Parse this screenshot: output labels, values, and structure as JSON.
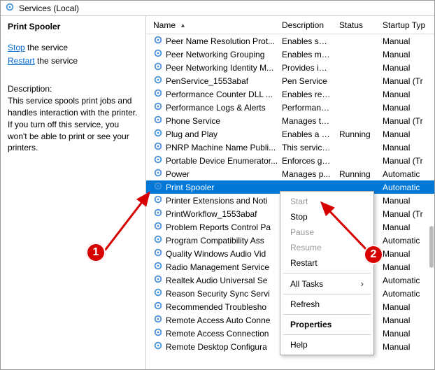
{
  "title": "Services (Local)",
  "left_pane": {
    "service_name": "Print Spooler",
    "stop_link": "Stop",
    "stop_suffix": " the service",
    "restart_link": "Restart",
    "restart_suffix": " the service",
    "desc_label": "Description:",
    "desc_text": "This service spools print jobs and handles interaction with the printer. If you turn off this service, you won't be able to print or see your printers."
  },
  "columns": {
    "name": "Name",
    "description": "Description",
    "status": "Status",
    "startup": "Startup Typ"
  },
  "rows": [
    {
      "name": "Peer Name Resolution Prot...",
      "desc": "Enables serv...",
      "status": "",
      "startup": "Manual"
    },
    {
      "name": "Peer Networking Grouping",
      "desc": "Enables mul...",
      "status": "",
      "startup": "Manual"
    },
    {
      "name": "Peer Networking Identity M...",
      "desc": "Provides ide...",
      "status": "",
      "startup": "Manual"
    },
    {
      "name": "PenService_1553abaf",
      "desc": "Pen Service",
      "status": "",
      "startup": "Manual (Tr"
    },
    {
      "name": "Performance Counter DLL ...",
      "desc": "Enables rem...",
      "status": "",
      "startup": "Manual"
    },
    {
      "name": "Performance Logs & Alerts",
      "desc": "Performanc...",
      "status": "",
      "startup": "Manual"
    },
    {
      "name": "Phone Service",
      "desc": "Manages th...",
      "status": "",
      "startup": "Manual (Tr"
    },
    {
      "name": "Plug and Play",
      "desc": "Enables a c...",
      "status": "Running",
      "startup": "Manual"
    },
    {
      "name": "PNRP Machine Name Publi...",
      "desc": "This service ...",
      "status": "",
      "startup": "Manual"
    },
    {
      "name": "Portable Device Enumerator...",
      "desc": "Enforces gr...",
      "status": "",
      "startup": "Manual (Tr"
    },
    {
      "name": "Power",
      "desc": "Manages p...",
      "status": "Running",
      "startup": "Automatic"
    },
    {
      "name": "Print Spooler",
      "desc": "",
      "status": "",
      "startup": "Automatic",
      "selected": true
    },
    {
      "name": "Printer Extensions and Noti",
      "desc": "",
      "status": "",
      "startup": "Manual"
    },
    {
      "name": "PrintWorkflow_1553abaf",
      "desc": "",
      "status": "",
      "startup": "Manual (Tr"
    },
    {
      "name": "Problem Reports Control Pa",
      "desc": "",
      "status": "",
      "startup": "Manual"
    },
    {
      "name": "Program Compatibility Ass",
      "desc": "",
      "status": "",
      "startup": "Automatic"
    },
    {
      "name": "Quality Windows Audio Vid",
      "desc": "",
      "status": "",
      "startup": "Manual"
    },
    {
      "name": "Radio Management Service",
      "desc": "",
      "status": "",
      "startup": "Manual"
    },
    {
      "name": "Realtek Audio Universal Se",
      "desc": "",
      "status": "",
      "startup": "Automatic"
    },
    {
      "name": "Reason Security Sync Servi",
      "desc": "",
      "status": "",
      "startup": "Automatic"
    },
    {
      "name": "Recommended Troublesho",
      "desc": "",
      "status": "",
      "startup": "Manual"
    },
    {
      "name": "Remote Access Auto Conne",
      "desc": "",
      "status": "",
      "startup": "Manual"
    },
    {
      "name": "Remote Access Connection",
      "desc": "",
      "status": "",
      "startup": "Manual"
    },
    {
      "name": "Remote Desktop Configura",
      "desc": "",
      "status": "",
      "startup": "Manual"
    }
  ],
  "context_menu": {
    "start": "Start",
    "stop": "Stop",
    "pause": "Pause",
    "resume": "Resume",
    "restart": "Restart",
    "all_tasks": "All Tasks",
    "refresh": "Refresh",
    "properties": "Properties",
    "help": "Help"
  },
  "annotations": {
    "one": "1",
    "two": "2"
  }
}
